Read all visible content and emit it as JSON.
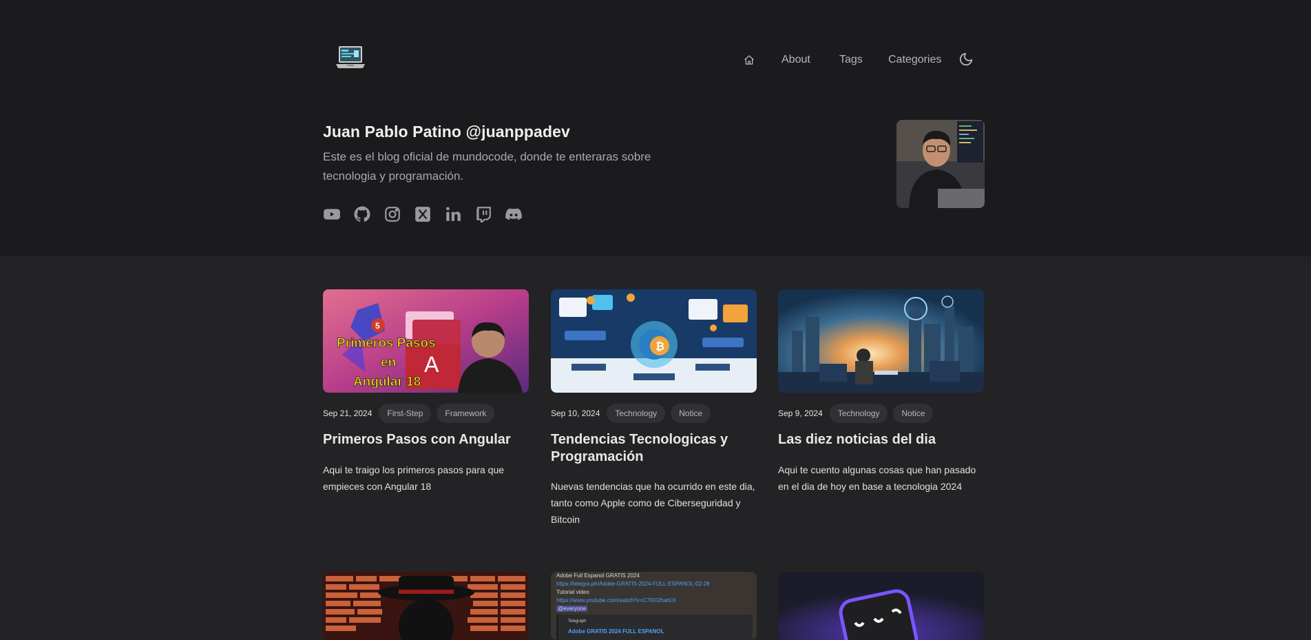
{
  "nav": {
    "home_icon": "home-icon",
    "items": [
      {
        "label": "About"
      },
      {
        "label": "Tags"
      },
      {
        "label": "Categories"
      }
    ],
    "theme_icon": "moon-icon"
  },
  "profile": {
    "name": "Juan Pablo Patino @juanppadev",
    "bio": "Este es el blog oficial de mundocode, donde te enteraras sobre tecnologia y programación.",
    "socials": [
      "youtube-icon",
      "github-icon",
      "instagram-icon",
      "x-icon",
      "linkedin-icon",
      "twitch-icon",
      "discord-icon"
    ]
  },
  "posts": [
    {
      "date": "Sep 21, 2024",
      "tags": [
        "First-Step",
        "Framework"
      ],
      "title": "Primeros Pasos con Angular",
      "description": "Aqui te traigo los primeros pasos para que empieces con Angular 18",
      "thumb": {
        "line1": "Primeros Pasos",
        "line2": "en",
        "line3": "Angular 18",
        "badge": "5"
      }
    },
    {
      "date": "Sep 10, 2024",
      "tags": [
        "Technology",
        "Notice"
      ],
      "title": "Tendencias Tecnologicas y Programación",
      "description": "Nuevas tendencias que ha ocurrido en este dia, tanto como Apple como de Ciberseguridad y Bitcoin"
    },
    {
      "date": "Sep 9, 2024",
      "tags": [
        "Technology",
        "Notice"
      ],
      "title": "Las diez noticias del dia",
      "description": "Aqui te cuento algunas cosas que han pasado en el dia de hoy en base a tecnologia 2024"
    }
  ],
  "second_row": {
    "adobe_post": {
      "line1": "Adobe Full Espanol GRATIS 2024",
      "link1": "https://telegra.ph/Adobe-GRATIS-2024-FULL-ESPANOL-02-28",
      "line2": "Tutorial video",
      "link2": "https://www.youtube.com/watch?v=C7lX02hahOI",
      "mention": "@everyone",
      "embed_site": "Telegraph",
      "embed_title": "Adobe GRATIS 2024 FULL ESPANOL"
    }
  },
  "colors": {
    "header_bg": "#1b1b1d",
    "body_bg": "#232325",
    "tag_bg": "#313133",
    "accent_link": "#4aa3ff"
  }
}
